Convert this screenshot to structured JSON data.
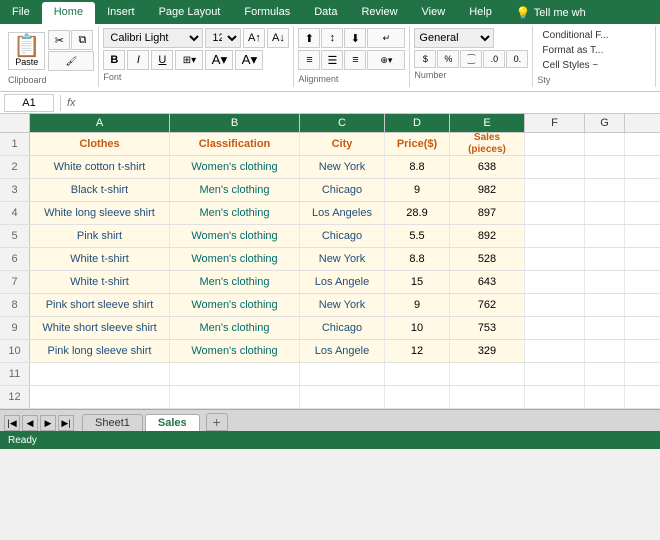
{
  "ribbon": {
    "tabs": [
      "File",
      "Home",
      "Insert",
      "Page Layout",
      "Formulas",
      "Data",
      "Review",
      "View",
      "Help"
    ],
    "active_tab": "Home",
    "tell_me": "Tell me wh",
    "font_name": "Calibri Light",
    "font_size": "12",
    "number_format": "General",
    "groups": {
      "clipboard": "Clipboard",
      "font": "Font",
      "alignment": "Alignment",
      "number": "Number",
      "styles": "Sty"
    },
    "styles_items": [
      "Conditional F...",
      "Format as T...",
      "Cell Styles ~"
    ]
  },
  "formula_bar": {
    "name_box": "A1",
    "fx": "fx"
  },
  "columns": {
    "headers": [
      "A",
      "B",
      "C",
      "D",
      "E",
      "F",
      "G"
    ],
    "widths": [
      140,
      130,
      85,
      65,
      75,
      60,
      40
    ]
  },
  "header_row": {
    "row_num": "1",
    "cells": [
      "Clothes",
      "Classification",
      "City",
      "Price($)",
      "Sales\n(pieces)",
      "",
      ""
    ]
  },
  "data_rows": [
    {
      "row": "2",
      "a": "White cotton t-shirt",
      "b": "Women's clothing",
      "c": "New York",
      "d": "8.8",
      "e": "638"
    },
    {
      "row": "3",
      "a": "Black t-shirt",
      "b": "Men's clothing",
      "c": "Chicago",
      "d": "9",
      "e": "982"
    },
    {
      "row": "4",
      "a": "White long sleeve shirt",
      "b": "Men's clothing",
      "c": "Los Angeles",
      "d": "28.9",
      "e": "897"
    },
    {
      "row": "5",
      "a": "Pink shirt",
      "b": "Women's clothing",
      "c": "Chicago",
      "d": "5.5",
      "e": "892"
    },
    {
      "row": "6",
      "a": "White t-shirt",
      "b": "Women's clothing",
      "c": "New York",
      "d": "8.8",
      "e": "528"
    },
    {
      "row": "7",
      "a": "White t-shirt",
      "b": "Men's clothing",
      "c": "Los Angele",
      "d": "15",
      "e": "643"
    },
    {
      "row": "8",
      "a": "Pink short sleeve shirt",
      "b": "Women's clothing",
      "c": "New York",
      "d": "9",
      "e": "762"
    },
    {
      "row": "9",
      "a": "White short sleeve shirt",
      "b": "Men's clothing",
      "c": "Chicago",
      "d": "10",
      "e": "753"
    },
    {
      "row": "10",
      "a": "Pink long sleeve shirt",
      "b": "Women's clothing",
      "c": "Los Angele",
      "d": "12",
      "e": "329"
    }
  ],
  "empty_rows": [
    "11",
    "12"
  ],
  "sheets": [
    "Sheet1",
    "Sales"
  ],
  "active_sheet": "Sales"
}
